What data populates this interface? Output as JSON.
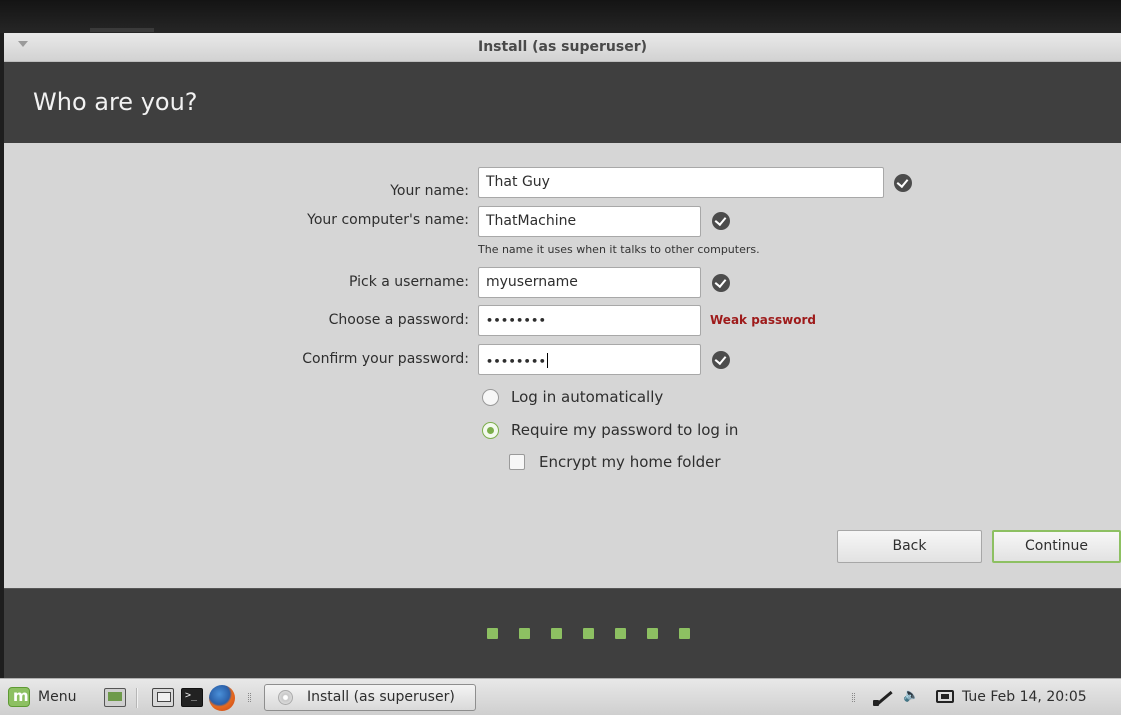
{
  "window": {
    "title": "Install (as superuser)"
  },
  "header": {
    "heading": "Who are you?"
  },
  "form": {
    "name_label": "Your name:",
    "name_value": "That Guy",
    "computer_label": "Your computer's name:",
    "computer_value": "ThatMachine",
    "computer_hint": "The name it uses when it talks to other computers.",
    "username_label": "Pick a username:",
    "username_value": "myusername",
    "password_label": "Choose a password:",
    "password_value": "••••••••",
    "password_strength": "Weak password",
    "confirm_label": "Confirm your password:",
    "confirm_value": "••••••••"
  },
  "login_options": {
    "auto_login_label": "Log in automatically",
    "require_password_label": "Require my password to log in",
    "selected": "require_password",
    "encrypt_label": "Encrypt my home folder",
    "encrypt_checked": false
  },
  "buttons": {
    "back_label": "Back",
    "continue_label": "Continue"
  },
  "progress": {
    "total_steps": 7,
    "color": "#8dc062"
  },
  "taskbar": {
    "menu_label": "Menu",
    "task_label": "Install (as superuser)",
    "clock": "Tue Feb 14, 20:05",
    "icons": [
      "mint-logo-icon",
      "show-desktop-icon",
      "files-icon",
      "terminal-icon",
      "firefox-icon",
      "cd-icon",
      "network-icon",
      "volume-icon",
      "battery-icon"
    ]
  },
  "colors": {
    "accent": "#8dc062",
    "header_bg": "#3f3f3f",
    "weak_password": "#9e1a1a"
  }
}
